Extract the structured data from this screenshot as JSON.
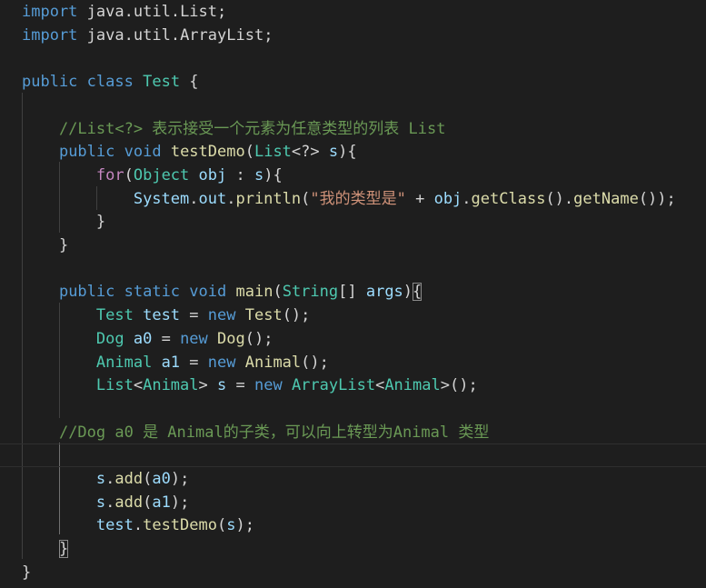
{
  "colors": {
    "background": "#1e1e1e",
    "keyword": "#569cd6",
    "control": "#c586c0",
    "type": "#4ec9b0",
    "function": "#dcdcaa",
    "variable": "#9cdcfe",
    "string": "#ce9178",
    "comment": "#6a9955",
    "punctuation": "#d4d4d4"
  },
  "code": {
    "lines": [
      {
        "tokens": [
          {
            "t": "import",
            "c": "kw"
          },
          {
            "t": " java",
            "c": "pun"
          },
          {
            "t": ".",
            "c": "pun"
          },
          {
            "t": "util",
            "c": "pun"
          },
          {
            "t": ".",
            "c": "pun"
          },
          {
            "t": "List",
            "c": "pun"
          },
          {
            "t": ";",
            "c": "pun"
          }
        ]
      },
      {
        "tokens": [
          {
            "t": "import",
            "c": "kw"
          },
          {
            "t": " java",
            "c": "pun"
          },
          {
            "t": ".",
            "c": "pun"
          },
          {
            "t": "util",
            "c": "pun"
          },
          {
            "t": ".",
            "c": "pun"
          },
          {
            "t": "ArrayList",
            "c": "pun"
          },
          {
            "t": ";",
            "c": "pun"
          }
        ]
      },
      {
        "tokens": []
      },
      {
        "tokens": [
          {
            "t": "public",
            "c": "kw"
          },
          {
            "t": " ",
            "c": "pun"
          },
          {
            "t": "class",
            "c": "kw"
          },
          {
            "t": " ",
            "c": "pun"
          },
          {
            "t": "Test",
            "c": "ty"
          },
          {
            "t": " {",
            "c": "pun"
          }
        ]
      },
      {
        "tokens": []
      },
      {
        "tokens": [
          {
            "t": "    ",
            "c": "pun"
          },
          {
            "t": "//List<?> 表示接受一个元素为任意类型的列表 List",
            "c": "cmt"
          }
        ]
      },
      {
        "tokens": [
          {
            "t": "    ",
            "c": "pun"
          },
          {
            "t": "public",
            "c": "kw"
          },
          {
            "t": " ",
            "c": "pun"
          },
          {
            "t": "void",
            "c": "kw"
          },
          {
            "t": " ",
            "c": "pun"
          },
          {
            "t": "testDemo",
            "c": "fn"
          },
          {
            "t": "(",
            "c": "pun"
          },
          {
            "t": "List",
            "c": "ty"
          },
          {
            "t": "<?> ",
            "c": "pun"
          },
          {
            "t": "s",
            "c": "var"
          },
          {
            "t": "){",
            "c": "pun"
          }
        ]
      },
      {
        "tokens": [
          {
            "t": "        ",
            "c": "pun"
          },
          {
            "t": "for",
            "c": "ctl"
          },
          {
            "t": "(",
            "c": "pun"
          },
          {
            "t": "Object",
            "c": "ty"
          },
          {
            "t": " ",
            "c": "pun"
          },
          {
            "t": "obj",
            "c": "var"
          },
          {
            "t": " : ",
            "c": "pun"
          },
          {
            "t": "s",
            "c": "var"
          },
          {
            "t": "){",
            "c": "pun"
          }
        ]
      },
      {
        "tokens": [
          {
            "t": "            ",
            "c": "pun"
          },
          {
            "t": "System",
            "c": "var"
          },
          {
            "t": ".",
            "c": "pun"
          },
          {
            "t": "out",
            "c": "var"
          },
          {
            "t": ".",
            "c": "pun"
          },
          {
            "t": "println",
            "c": "fn"
          },
          {
            "t": "(",
            "c": "pun"
          },
          {
            "t": "\"我的类型是\"",
            "c": "str"
          },
          {
            "t": " + ",
            "c": "pun"
          },
          {
            "t": "obj",
            "c": "var"
          },
          {
            "t": ".",
            "c": "pun"
          },
          {
            "t": "getClass",
            "c": "fn"
          },
          {
            "t": "().",
            "c": "pun"
          },
          {
            "t": "getName",
            "c": "fn"
          },
          {
            "t": "());",
            "c": "pun"
          }
        ]
      },
      {
        "tokens": [
          {
            "t": "        }",
            "c": "pun"
          }
        ]
      },
      {
        "tokens": [
          {
            "t": "    }",
            "c": "pun"
          }
        ]
      },
      {
        "tokens": []
      },
      {
        "tokens": [
          {
            "t": "    ",
            "c": "pun"
          },
          {
            "t": "public",
            "c": "kw"
          },
          {
            "t": " ",
            "c": "pun"
          },
          {
            "t": "static",
            "c": "kw"
          },
          {
            "t": " ",
            "c": "pun"
          },
          {
            "t": "void",
            "c": "kw"
          },
          {
            "t": " ",
            "c": "pun"
          },
          {
            "t": "main",
            "c": "fn"
          },
          {
            "t": "(",
            "c": "pun"
          },
          {
            "t": "String",
            "c": "ty"
          },
          {
            "t": "[] ",
            "c": "pun"
          },
          {
            "t": "args",
            "c": "var"
          },
          {
            "t": ")",
            "c": "pun"
          },
          {
            "t": "{",
            "c": "pun",
            "box": true
          }
        ]
      },
      {
        "tokens": [
          {
            "t": "        ",
            "c": "pun"
          },
          {
            "t": "Test",
            "c": "ty"
          },
          {
            "t": " ",
            "c": "pun"
          },
          {
            "t": "test",
            "c": "var"
          },
          {
            "t": " = ",
            "c": "pun"
          },
          {
            "t": "new",
            "c": "kw"
          },
          {
            "t": " ",
            "c": "pun"
          },
          {
            "t": "Test",
            "c": "fn"
          },
          {
            "t": "();",
            "c": "pun"
          }
        ]
      },
      {
        "tokens": [
          {
            "t": "        ",
            "c": "pun"
          },
          {
            "t": "Dog",
            "c": "ty"
          },
          {
            "t": " ",
            "c": "pun"
          },
          {
            "t": "a0",
            "c": "var"
          },
          {
            "t": " = ",
            "c": "pun"
          },
          {
            "t": "new",
            "c": "kw"
          },
          {
            "t": " ",
            "c": "pun"
          },
          {
            "t": "Dog",
            "c": "fn"
          },
          {
            "t": "();",
            "c": "pun"
          }
        ]
      },
      {
        "tokens": [
          {
            "t": "        ",
            "c": "pun"
          },
          {
            "t": "Animal",
            "c": "ty"
          },
          {
            "t": " ",
            "c": "pun"
          },
          {
            "t": "a1",
            "c": "var"
          },
          {
            "t": " = ",
            "c": "pun"
          },
          {
            "t": "new",
            "c": "kw"
          },
          {
            "t": " ",
            "c": "pun"
          },
          {
            "t": "Animal",
            "c": "fn"
          },
          {
            "t": "();",
            "c": "pun"
          }
        ]
      },
      {
        "tokens": [
          {
            "t": "        ",
            "c": "pun"
          },
          {
            "t": "List",
            "c": "ty"
          },
          {
            "t": "<",
            "c": "pun"
          },
          {
            "t": "Animal",
            "c": "ty"
          },
          {
            "t": "> ",
            "c": "pun"
          },
          {
            "t": "s",
            "c": "var"
          },
          {
            "t": " = ",
            "c": "pun"
          },
          {
            "t": "new",
            "c": "kw"
          },
          {
            "t": " ",
            "c": "pun"
          },
          {
            "t": "ArrayList",
            "c": "ty"
          },
          {
            "t": "<",
            "c": "pun"
          },
          {
            "t": "Animal",
            "c": "ty"
          },
          {
            "t": ">();",
            "c": "pun"
          }
        ]
      },
      {
        "tokens": []
      },
      {
        "tokens": [
          {
            "t": "    ",
            "c": "pun"
          },
          {
            "t": "//Dog a0 是 Animal的子类，可以向上转型为Animal 类型",
            "c": "cmt"
          }
        ]
      },
      {
        "tokens": [],
        "current": true
      },
      {
        "tokens": [
          {
            "t": "        ",
            "c": "pun"
          },
          {
            "t": "s",
            "c": "var"
          },
          {
            "t": ".",
            "c": "pun"
          },
          {
            "t": "add",
            "c": "fn"
          },
          {
            "t": "(",
            "c": "pun"
          },
          {
            "t": "a0",
            "c": "var"
          },
          {
            "t": ");",
            "c": "pun"
          }
        ]
      },
      {
        "tokens": [
          {
            "t": "        ",
            "c": "pun"
          },
          {
            "t": "s",
            "c": "var"
          },
          {
            "t": ".",
            "c": "pun"
          },
          {
            "t": "add",
            "c": "fn"
          },
          {
            "t": "(",
            "c": "pun"
          },
          {
            "t": "a1",
            "c": "var"
          },
          {
            "t": ");",
            "c": "pun"
          }
        ]
      },
      {
        "tokens": [
          {
            "t": "        ",
            "c": "pun"
          },
          {
            "t": "test",
            "c": "var"
          },
          {
            "t": ".",
            "c": "pun"
          },
          {
            "t": "testDemo",
            "c": "fn"
          },
          {
            "t": "(",
            "c": "pun"
          },
          {
            "t": "s",
            "c": "var"
          },
          {
            "t": ");",
            "c": "pun"
          }
        ]
      },
      {
        "tokens": [
          {
            "t": "    ",
            "c": "pun"
          },
          {
            "t": "}",
            "c": "pun",
            "box": true
          }
        ]
      },
      {
        "tokens": [
          {
            "t": "}",
            "c": "pun"
          }
        ]
      }
    ]
  }
}
